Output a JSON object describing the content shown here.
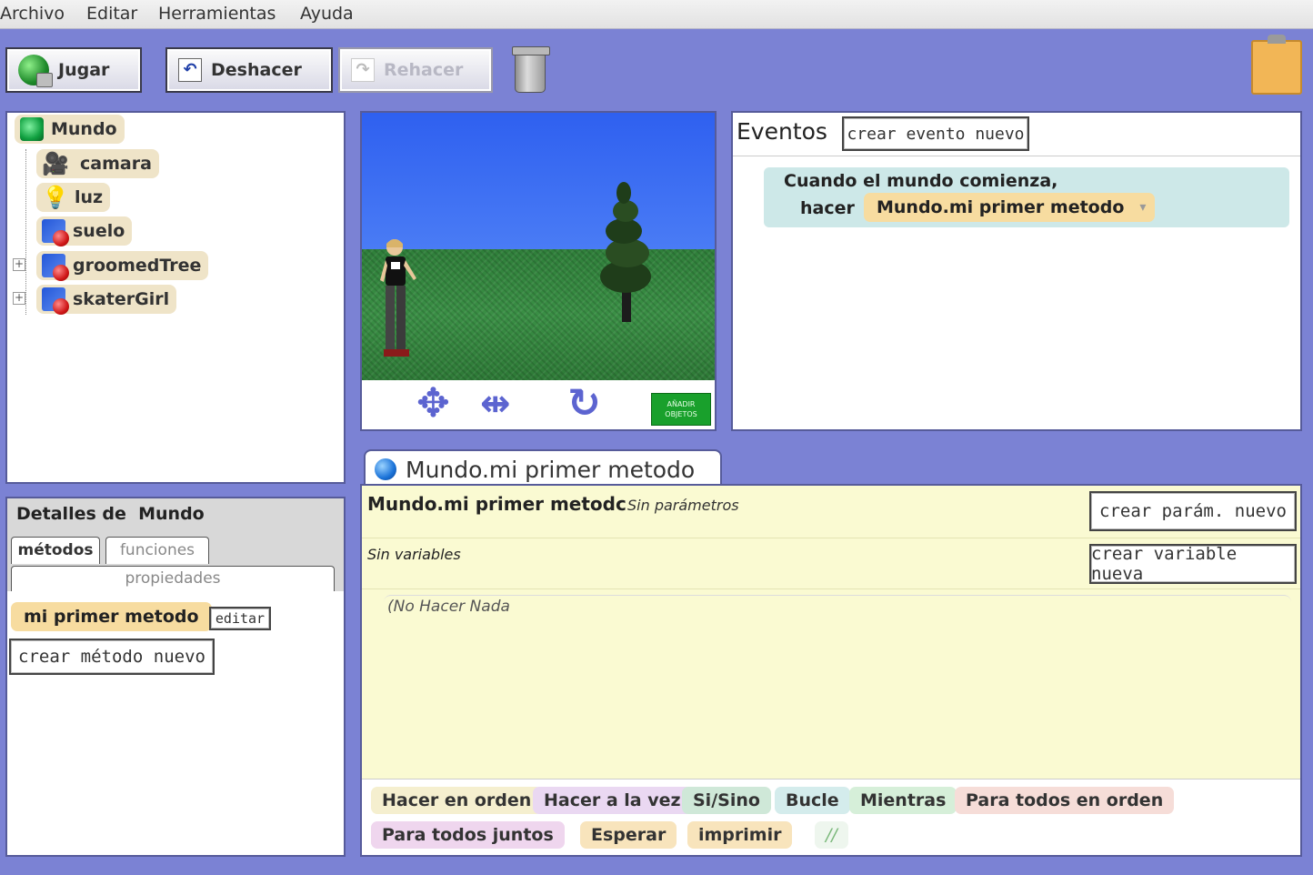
{
  "menu": [
    "Archivo",
    "Editar",
    "Herramientas",
    "Ayuda"
  ],
  "toolbar": {
    "play": "Jugar",
    "undo": "Deshacer",
    "redo": "Rehacer"
  },
  "object_tree": {
    "root": "Mundo",
    "items": [
      {
        "label": "camara",
        "icon": "camera-icon",
        "expandable": false
      },
      {
        "label": "luz",
        "icon": "light-bulb-icon",
        "expandable": false
      },
      {
        "label": "suelo",
        "icon": "object-icon",
        "expandable": false
      },
      {
        "label": "groomedTree",
        "icon": "object-icon",
        "expandable": true
      },
      {
        "label": "skaterGirl",
        "icon": "object-icon",
        "expandable": true
      }
    ]
  },
  "scene": {
    "add_objects_line1": "AÑADIR",
    "add_objects_line2": "OBJETOS"
  },
  "events": {
    "title": "Eventos",
    "create_button": "crear evento nuevo",
    "event_when": "Cuando el mundo comienza,",
    "event_do": "hacer",
    "event_method": "Mundo.mi primer metodo"
  },
  "details": {
    "title": "Detalles de  Mundo",
    "tabs": [
      "métodos",
      "funciones",
      "propiedades"
    ],
    "method": "mi primer metodo",
    "edit": "editar",
    "create_method": "crear método nuevo"
  },
  "editor": {
    "tab_title": "Mundo.mi primer metodo",
    "method_name": "Mundo.mi primer metodc",
    "no_params": "Sin parámetros",
    "create_param": "crear parám. nuevo",
    "no_vars": "Sin variables",
    "create_var": "crear variable nueva",
    "do_nothing": "(No Hacer Nada",
    "tiles_row1": [
      "Hacer en orden",
      "Hacer a la vez",
      "Si/Sino",
      "Bucle",
      "Mientras",
      "Para todos en orden"
    ],
    "tiles_row2": [
      "Para todos juntos",
      "Esperar",
      "imprimir",
      "//"
    ]
  },
  "colors": {
    "background": "#7b82d4",
    "editor": "#fafad2",
    "event_block": "#cde8e8",
    "method_tile": "#f7dca0"
  }
}
